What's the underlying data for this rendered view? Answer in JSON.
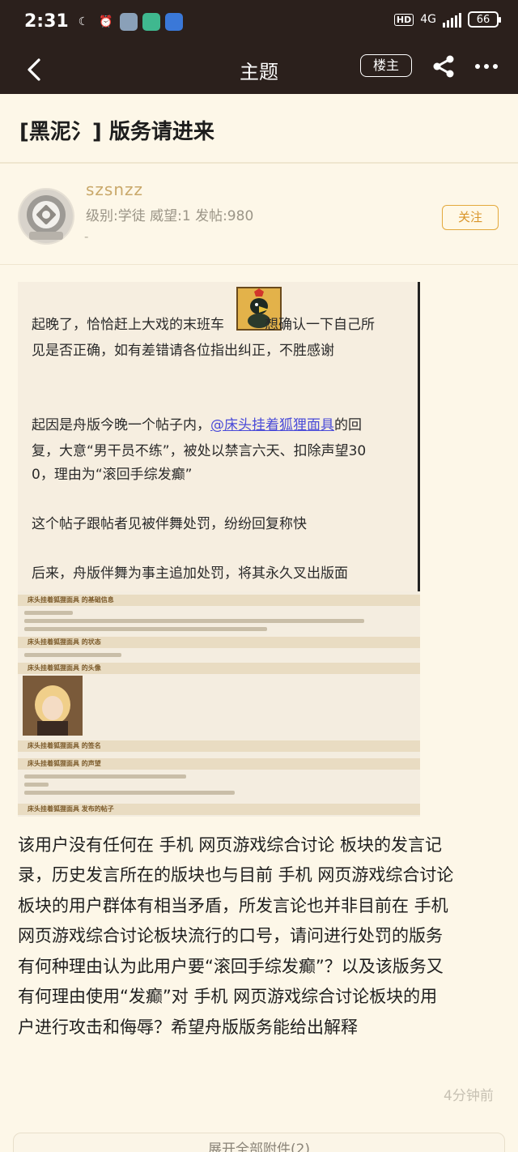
{
  "status_bar": {
    "time": "2:31",
    "network": "4G",
    "battery": "66",
    "icons": [
      "moon-icon",
      "alarm-icon",
      "app-icon-1",
      "app-icon-2",
      "app-icon-3"
    ]
  },
  "appbar": {
    "title": "主题",
    "louzhu_label": "楼主",
    "icons": [
      "back-icon",
      "share-icon",
      "more-icon"
    ]
  },
  "thread": {
    "title": "[黑泥氵] 版务请进来"
  },
  "author": {
    "name": "szsnzz",
    "meta": "级别:学徒 威望:1 发帖:980",
    "meta2": "-",
    "follow_label": "关注"
  },
  "screenshot1": {
    "line1a": "起晚了，恰恰赶上大戏的末班车",
    "line1b": "想确认一下自己所",
    "line2": "见是否正确，如有差错请各位指出纠正，不胜感谢",
    "line3a": "起因是舟版今晚一个帖子内，",
    "line3_mention": "@床头挂着狐狸面具",
    "line3b": "的回",
    "line4": "复，大意“男干员不练”，被处以禁言六天、扣除声望30",
    "line5": "0，理由为“滚回手综发癫”",
    "line6": "这个帖子跟帖者见被伴舞处罚，纷纷回复称快",
    "line7": "后来，舟版伴舞为事主追加处罚，将其永久叉出版面"
  },
  "screenshot2": {
    "header1": "床头挂着狐狸面具 的基础信息",
    "header2": "床头挂着狐狸面具 的状态",
    "header3": "床头挂着狐狸面具 的头像",
    "header4": "床头挂着狐狸面具 的签名",
    "header5": "床头挂着狐狸面具 的声望",
    "header6": "床头挂着狐狸面具 发布的帖子"
  },
  "body": {
    "lines": [
      "该用户没有任何在 手机 网页游戏综合讨论 板块的发言记",
      "录，历史发言所在的版块也与目前 手机 网页游戏综合讨论",
      "板块的用户群体有相当矛盾，所发言论也并非目前在 手机",
      "网页游戏综合讨论板块流行的口号，请问进行处罚的版务",
      "有何种理由认为此用户要“滚回手综发癫”？以及该版务又",
      "有何理由使用“发癫”对 手机 网页游戏综合讨论板块的用",
      "户进行攻击和侮辱？希望舟版版务能给出解释"
    ]
  },
  "footer": {
    "timestamp": "4分钟前",
    "attachments_label": "展开全部附件(2)"
  }
}
